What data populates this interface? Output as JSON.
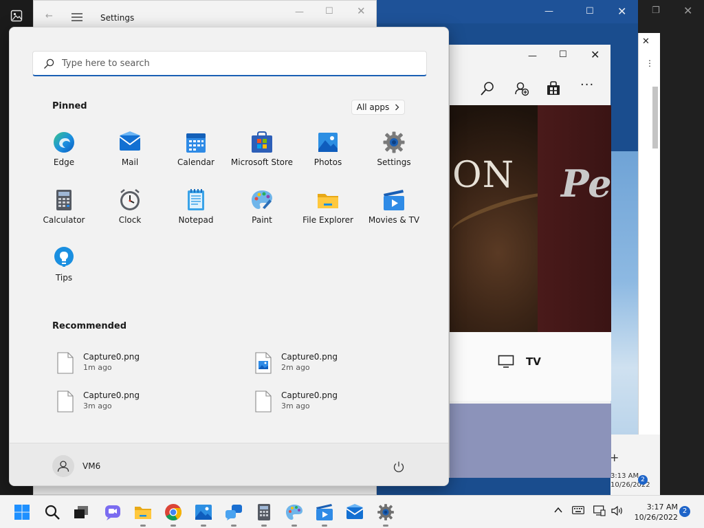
{
  "settings_window": {
    "title": "Settings"
  },
  "movies_window": {
    "banner_text_1": "ON",
    "banner_text_2": "Pe",
    "tv_label": "TV"
  },
  "background_clock": {
    "time": "3:13 AM",
    "date": "10/26/2022",
    "badge": "2"
  },
  "start_menu": {
    "search": {
      "placeholder": "Type here to search",
      "value": ""
    },
    "pinned_heading": "Pinned",
    "all_apps_label": "All apps",
    "pinned": [
      {
        "label": "Edge",
        "icon": "edge-icon"
      },
      {
        "label": "Mail",
        "icon": "mail-icon"
      },
      {
        "label": "Calendar",
        "icon": "calendar-icon"
      },
      {
        "label": "Microsoft Store",
        "icon": "store-icon"
      },
      {
        "label": "Photos",
        "icon": "photos-icon"
      },
      {
        "label": "Settings",
        "icon": "gear-icon"
      },
      {
        "label": "Calculator",
        "icon": "calculator-icon"
      },
      {
        "label": "Clock",
        "icon": "clock-icon"
      },
      {
        "label": "Notepad",
        "icon": "notepad-icon"
      },
      {
        "label": "Paint",
        "icon": "paint-icon"
      },
      {
        "label": "File Explorer",
        "icon": "folder-icon"
      },
      {
        "label": "Movies & TV",
        "icon": "movies-icon"
      },
      {
        "label": "Tips",
        "icon": "lightbulb-icon"
      }
    ],
    "recommended_heading": "Recommended",
    "recommended": [
      {
        "name": "Capture0.png",
        "time": "1m ago",
        "icon": "file-icon"
      },
      {
        "name": "Capture0.png",
        "time": "2m ago",
        "icon": "image-file-icon"
      },
      {
        "name": "Capture0.png",
        "time": "3m ago",
        "icon": "file-icon"
      },
      {
        "name": "Capture0.png",
        "time": "3m ago",
        "icon": "file-icon"
      }
    ],
    "user_name": "VM6"
  },
  "taskbar": {
    "apps": [
      "start-icon",
      "search-icon",
      "task-view-icon",
      "chat-icon",
      "folder-icon",
      "chrome-icon",
      "photos-icon",
      "people-icon",
      "calculator-icon",
      "paint-icon",
      "movies-icon",
      "mail-icon",
      "gear-icon"
    ],
    "clock": {
      "time": "3:17 AM",
      "date": "10/26/2022"
    },
    "notification_badge": "2"
  },
  "colors": {
    "accent": "#1a5fb4",
    "start_bg": "#f2f2f2",
    "desktop_blue": "#1a4d8e",
    "taskbar_bg": "#f3f3f3"
  }
}
